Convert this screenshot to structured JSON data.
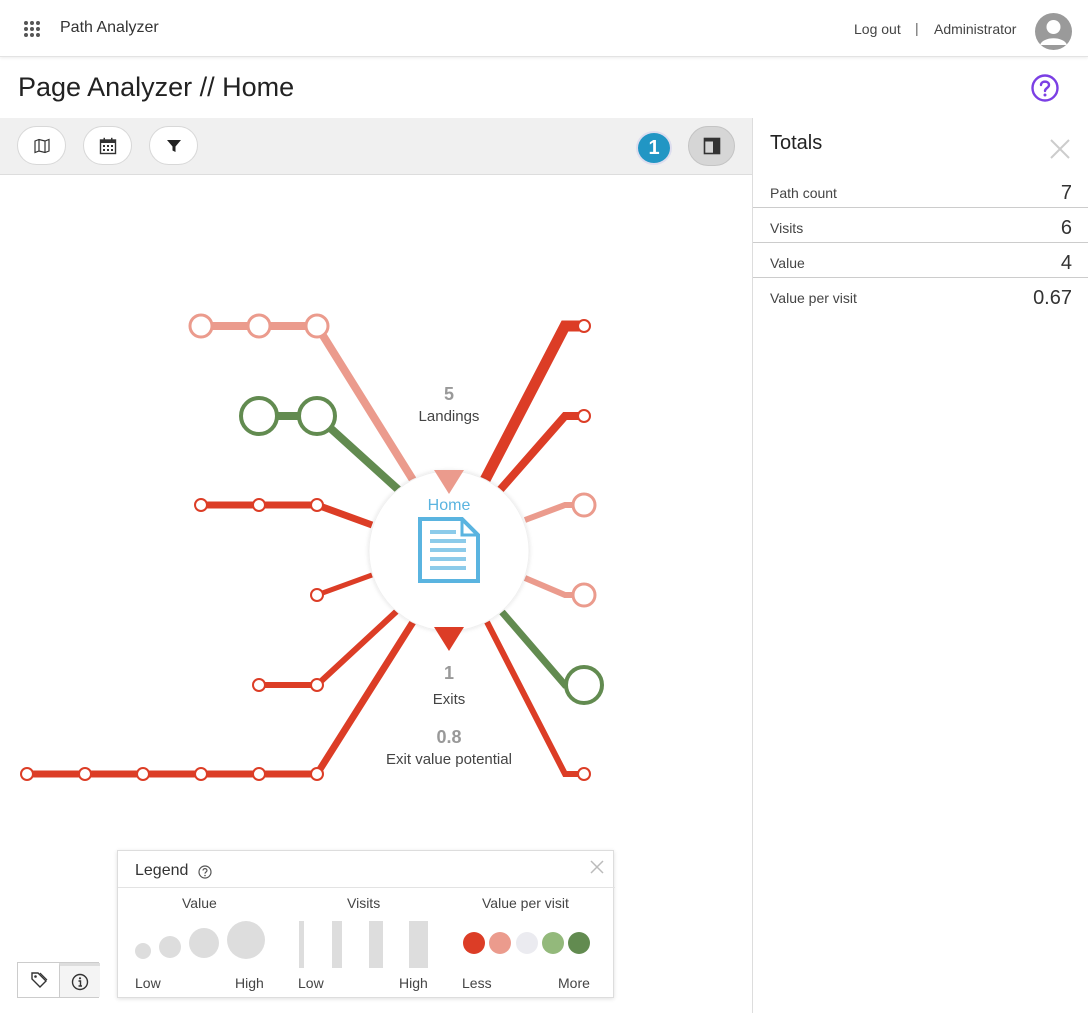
{
  "header": {
    "app_title": "Path Analyzer",
    "logout_label": "Log out",
    "separator": "|",
    "user_name": "Administrator"
  },
  "page": {
    "title": "Page Analyzer // Home"
  },
  "toolbar": {
    "badge_count": "1",
    "icons": [
      "map-icon",
      "calendar-icon",
      "filter-icon",
      "panel-layout-icon"
    ]
  },
  "graph": {
    "center_label": "Home",
    "landings_value": "5",
    "landings_label": "Landings",
    "exits_value": "1",
    "exits_label": "Exits",
    "exit_value_potential_value": "0.8",
    "exit_value_potential_label": "Exit value potential",
    "colors": {
      "less": "#dc3d26",
      "low": "#eb9b8d",
      "neutral": "#ebebf0",
      "high": "#93b97b",
      "more": "#628b50",
      "node_blue": "#5ab4e0"
    }
  },
  "totals": {
    "title": "Totals",
    "rows": [
      {
        "label": "Path count",
        "value": "7"
      },
      {
        "label": "Visits",
        "value": "6"
      },
      {
        "label": "Value",
        "value": "4"
      },
      {
        "label": "Value per visit",
        "value": "0.67"
      }
    ]
  },
  "legend": {
    "title": "Legend",
    "value_heading": "Value",
    "visits_heading": "Visits",
    "vpv_heading": "Value per visit",
    "value_low": "Low",
    "value_high": "High",
    "visits_low": "Low",
    "visits_high": "High",
    "vpv_less": "Less",
    "vpv_more": "More"
  }
}
